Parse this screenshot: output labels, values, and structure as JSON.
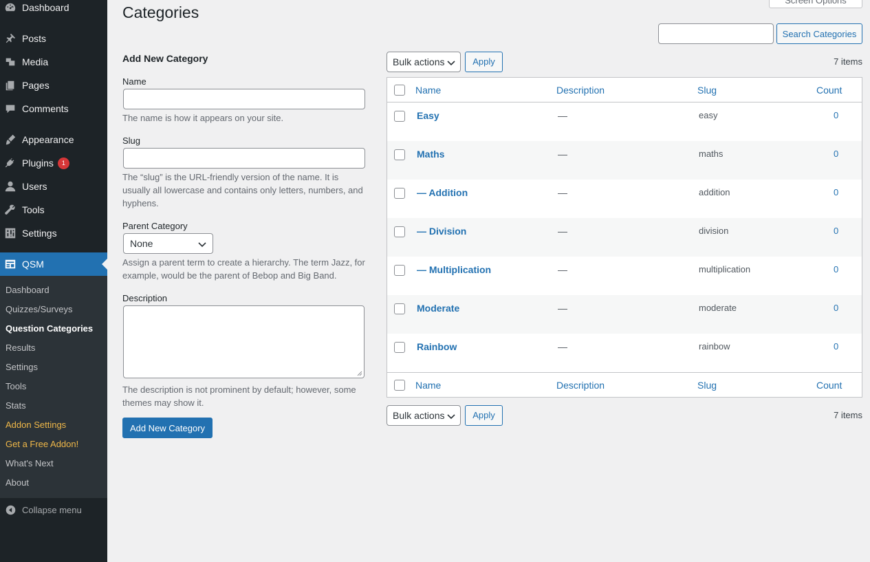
{
  "sidebar": {
    "items": [
      {
        "label": "Dashboard",
        "icon": "dashboard-icon"
      },
      {
        "label": "Posts",
        "icon": "pin-icon"
      },
      {
        "label": "Media",
        "icon": "media-icon"
      },
      {
        "label": "Pages",
        "icon": "pages-icon"
      },
      {
        "label": "Comments",
        "icon": "comment-icon"
      },
      {
        "label": "Appearance",
        "icon": "brush-icon"
      },
      {
        "label": "Plugins",
        "icon": "plugin-icon",
        "badge": "1"
      },
      {
        "label": "Users",
        "icon": "user-icon"
      },
      {
        "label": "Tools",
        "icon": "wrench-icon"
      },
      {
        "label": "Settings",
        "icon": "settings-icon"
      }
    ],
    "active": {
      "label": "QSM",
      "icon": "qsm-icon"
    },
    "submenu": [
      "Dashboard",
      "Quizzes/Surveys",
      "Question Categories",
      "Results",
      "Settings",
      "Tools",
      "Stats",
      "Addon Settings",
      "Get a Free Addon!",
      "What's Next",
      "About"
    ],
    "collapse_label": "Collapse menu"
  },
  "header": {
    "title": "Categories",
    "screen_options": "Screen Options",
    "search_placeholder": "",
    "search_button": "Search Categories"
  },
  "form": {
    "heading": "Add New Category",
    "name_label": "Name",
    "name_help": "The name is how it appears on your site.",
    "slug_label": "Slug",
    "slug_help": "The “slug” is the URL-friendly version of the name. It is usually all lowercase and contains only letters, numbers, and hyphens.",
    "parent_label": "Parent Category",
    "parent_value": "None",
    "parent_help": "Assign a parent term to create a hierarchy. The term Jazz, for example, would be the parent of Bebop and Big Band.",
    "desc_label": "Description",
    "desc_help": "The description is not prominent by default; however, some themes may show it.",
    "submit": "Add New Category"
  },
  "table": {
    "bulk_label": "Bulk actions",
    "apply_label": "Apply",
    "items_count": "7 items",
    "columns": {
      "name": "Name",
      "description": "Description",
      "slug": "Slug",
      "count": "Count"
    },
    "rows": [
      {
        "name": "Easy",
        "description": "—",
        "slug": "easy",
        "count": "0"
      },
      {
        "name": "Maths",
        "description": "—",
        "slug": "maths",
        "count": "0"
      },
      {
        "name": "— Addition",
        "description": "—",
        "slug": "addition",
        "count": "0"
      },
      {
        "name": "— Division",
        "description": "—",
        "slug": "division",
        "count": "0"
      },
      {
        "name": "— Multiplication",
        "description": "—",
        "slug": "multiplication",
        "count": "0"
      },
      {
        "name": "Moderate",
        "description": "—",
        "slug": "moderate",
        "count": "0"
      },
      {
        "name": "Rainbow",
        "description": "—",
        "slug": "rainbow",
        "count": "0"
      }
    ]
  }
}
